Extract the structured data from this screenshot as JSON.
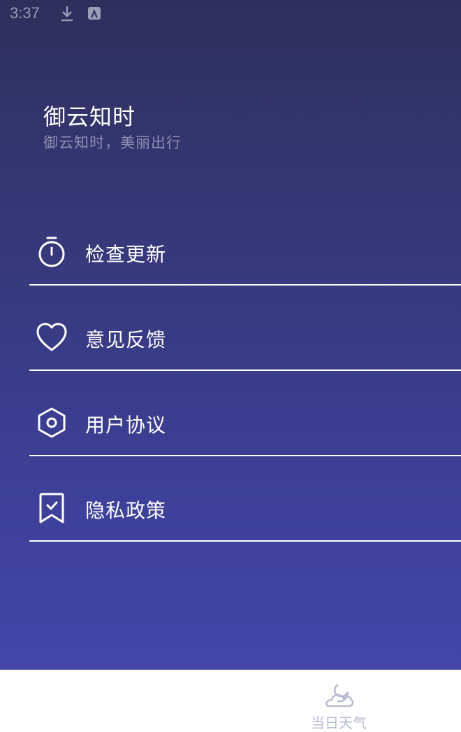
{
  "status_bar": {
    "time": "3:37",
    "icons": [
      "download-icon",
      "a-box-icon"
    ]
  },
  "header": {
    "title": "御云知时",
    "subtitle": "御云知时，美丽出行"
  },
  "menu": {
    "items": [
      {
        "label": "检查更新",
        "icon": "stopwatch-icon"
      },
      {
        "label": "意见反馈",
        "icon": "heart-icon"
      },
      {
        "label": "用户协议",
        "icon": "hexagon-icon"
      },
      {
        "label": "隐私政策",
        "icon": "bookmark-check-icon"
      }
    ]
  },
  "bottom_nav": {
    "tabs": [
      {
        "label": "当日天气",
        "icon": "moon-cloud-icon"
      }
    ]
  },
  "colors": {
    "gradient_top": "#2e2f5c",
    "gradient_bottom": "#4446aa",
    "subtitle": "#8e8fb4",
    "tab_inactive": "#b9bbd3"
  }
}
